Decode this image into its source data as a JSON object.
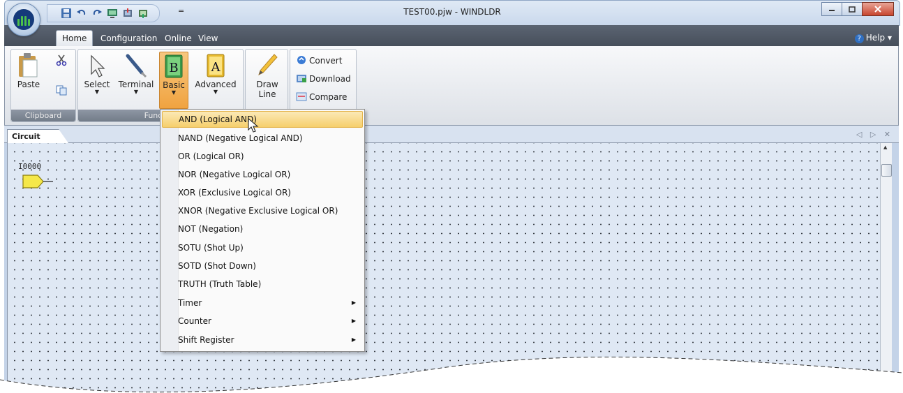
{
  "window": {
    "title": "TEST00.pjw - WINDLDR",
    "caption_buttons": [
      "minimize-icon",
      "maximize-icon",
      "close-icon"
    ]
  },
  "quick_access": {
    "icons": [
      "save-icon",
      "undo-icon",
      "redo-icon",
      "monitor-icon",
      "download-icon",
      "upload-icon"
    ],
    "customize_glyph": "="
  },
  "ribbon_tabs": [
    {
      "label": "Home",
      "active": true
    },
    {
      "label": "Configuration",
      "active": false
    },
    {
      "label": "Online",
      "active": false
    },
    {
      "label": "View",
      "active": false
    }
  ],
  "help": {
    "label": "Help",
    "glyph": "?",
    "arrow": "▾"
  },
  "groups": {
    "clipboard": {
      "label": "Clipboard",
      "paste_label": "Paste"
    },
    "function": {
      "label": "Function",
      "select_label": "Select",
      "terminal_label": "Terminal",
      "basic_label": "Basic",
      "basic_letter": "B",
      "advanced_label": "Advanced",
      "advanced_letter": "A",
      "draw_line_label_1": "Draw",
      "draw_line_label_2": "Line"
    },
    "tools": {
      "convert_label": "Convert",
      "download_label": "Download",
      "compare_label": "Compare"
    }
  },
  "document": {
    "tab_label": "Circuit",
    "nav_glyphs": "◁ ▷ ✕",
    "io_label": "I0000"
  },
  "basic_menu": {
    "items": [
      {
        "label": "AND (Logical AND)",
        "highlighted": true,
        "submenu": false
      },
      {
        "label": "NAND (Negative Logical AND)",
        "highlighted": false,
        "submenu": false
      },
      {
        "label": "OR (Logical OR)",
        "highlighted": false,
        "submenu": false
      },
      {
        "label": "NOR (Negative Logical OR)",
        "highlighted": false,
        "submenu": false
      },
      {
        "label": "XOR (Exclusive Logical OR)",
        "highlighted": false,
        "submenu": false
      },
      {
        "label": "XNOR (Negative Exclusive Logical OR)",
        "highlighted": false,
        "submenu": false
      },
      {
        "label": "NOT (Negation)",
        "highlighted": false,
        "submenu": false
      },
      {
        "label": "SOTU (Shot Up)",
        "highlighted": false,
        "submenu": false
      },
      {
        "label": "SOTD (Shot Down)",
        "highlighted": false,
        "submenu": false
      },
      {
        "label": "TRUTH (Truth Table)",
        "highlighted": false,
        "submenu": false
      },
      {
        "label": "Timer",
        "highlighted": false,
        "submenu": true
      },
      {
        "label": "Counter",
        "highlighted": false,
        "submenu": true
      },
      {
        "label": "Shift Register",
        "highlighted": false,
        "submenu": true
      }
    ],
    "submenu_glyph": "▶"
  },
  "colors": {
    "highlight": "#f6cf6c",
    "pressed_button": "#f0a340",
    "io_fill": "#f5e84a",
    "canvas": "#dfe8f4"
  }
}
